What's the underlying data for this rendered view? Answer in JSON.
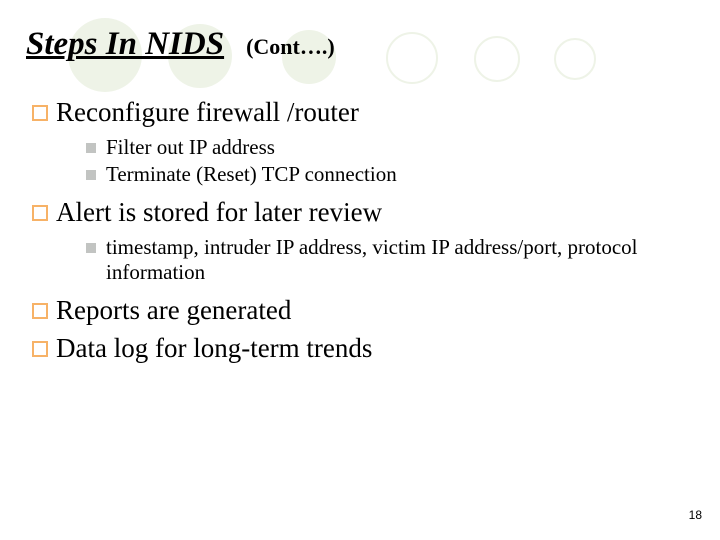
{
  "title": {
    "main": "Steps In NIDS",
    "cont": "(Cont….)"
  },
  "points": [
    {
      "text": "Reconfigure firewall /router",
      "sub": [
        "Filter out IP address",
        "Terminate (Reset) TCP connection"
      ]
    },
    {
      "text": "Alert is stored for later review",
      "sub": [
        "timestamp, intruder IP address, victim IP address/port, protocol information"
      ]
    },
    {
      "text": "Reports are generated",
      "sub": []
    },
    {
      "text": "Data log for long-term trends",
      "sub": []
    }
  ],
  "page_number": "18"
}
